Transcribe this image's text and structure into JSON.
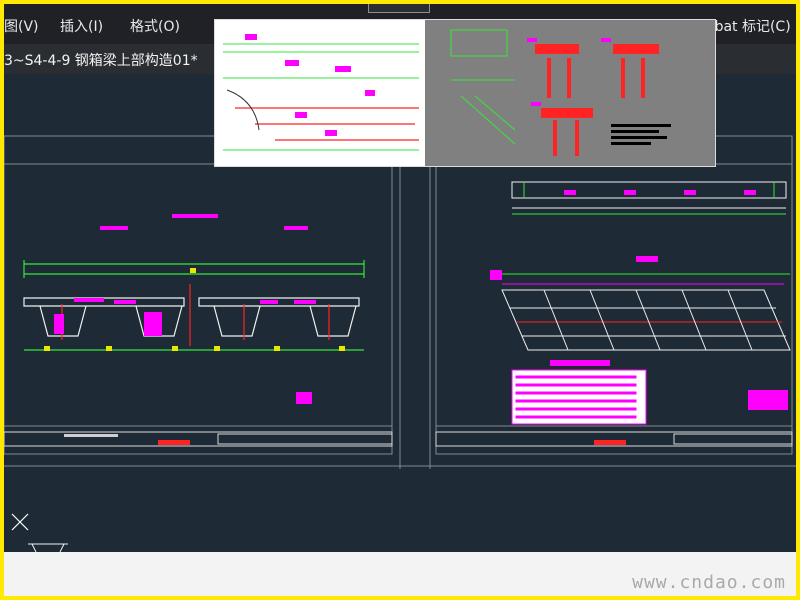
{
  "menubar": {
    "items": [
      {
        "id": "view",
        "label": "图(V)"
      },
      {
        "id": "insert",
        "label": "插入(I)"
      },
      {
        "id": "format",
        "label": "格式(O)"
      },
      {
        "id": "acrobat",
        "label": "obat 标记(C)"
      }
    ]
  },
  "document": {
    "title": "3~S4-4-9 钢箱梁上部构造01*"
  },
  "watermark": "www.cndao.com",
  "colors": {
    "frame_border": "#ffe900",
    "canvas_bg": "#1e2a36",
    "menubar_bg": "#1f2126",
    "cad_green": "#37e638",
    "cad_magenta": "#ff00ff",
    "cad_red": "#ff2323",
    "cad_white": "#f0f0f0",
    "cad_yellow": "#e8e800"
  },
  "icons": {
    "crosshair": "crosshair-cursor-icon"
  }
}
